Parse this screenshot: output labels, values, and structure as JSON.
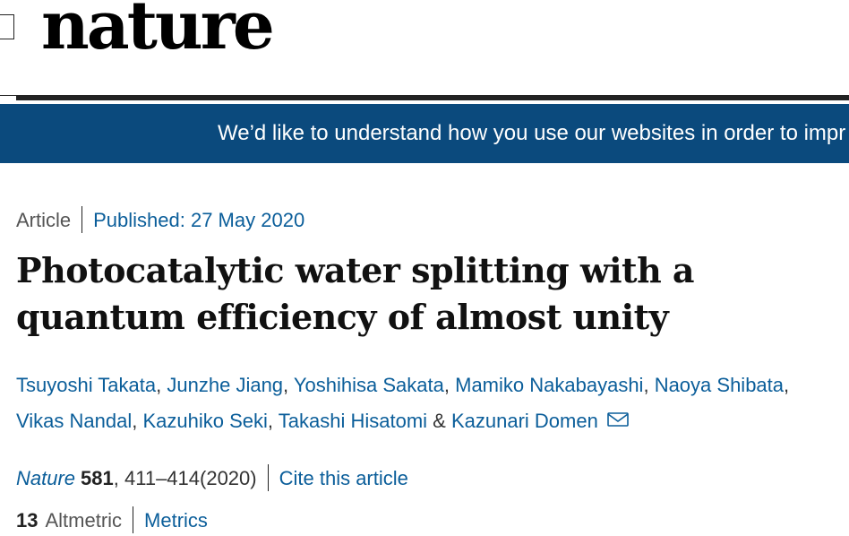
{
  "header": {
    "logo_text": "nature"
  },
  "banner": {
    "text": "We’d like to understand how you use our websites in order to impr"
  },
  "article": {
    "type": "Article",
    "published": "Published: 27 May 2020",
    "title": "Photocatalytic water splitting with a quantum efficiency of almost unity",
    "authors": [
      "Tsuyoshi Takata",
      "Junzhe Jiang",
      "Yoshihisa Sakata",
      "Mamiko Nakabayashi",
      "Naoya Shibata",
      "Vikas Nandal",
      "Kazuhiko Seki",
      "Takashi Hisatomi",
      "Kazunari Domen"
    ],
    "comma": ",",
    "ampersand": "&",
    "journal": "Nature",
    "volume": "581",
    "pages": ", 411–414(2020)",
    "cite_label": "Cite this article",
    "altmetric_count": "13",
    "altmetric_label": "Altmetric",
    "metrics_label": "Metrics"
  },
  "colors": {
    "banner": "#0b4a7d",
    "link": "#0b5e9a"
  }
}
